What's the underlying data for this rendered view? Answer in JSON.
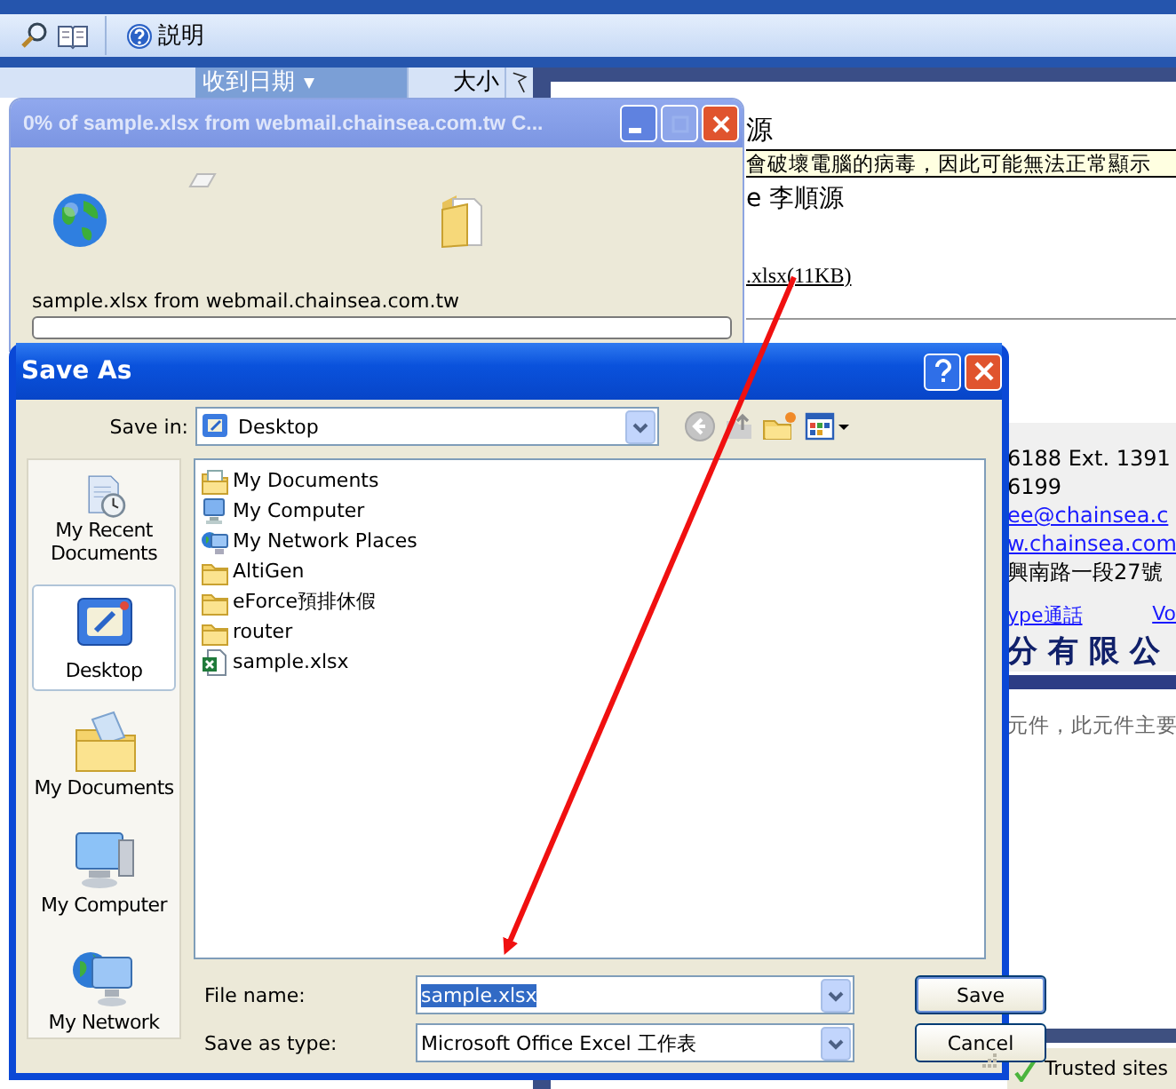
{
  "browser": {
    "toolbar": {
      "help_label": "説明"
    },
    "message_list": {
      "columns": [
        {
          "label": "收到日期",
          "selected": true
        },
        {
          "label": "大小",
          "selected": false
        }
      ]
    },
    "reading_pane": {
      "sender_fragment": "源",
      "notice": "會破壞電腦的病毒，因此可能無法正常顯示",
      "recipient_fragment": "e 李順源",
      "attachment_link": ".xlsx(11KB)",
      "signature": {
        "lines": [
          {
            "text": "6188 Ext. 1391",
            "kind": "text"
          },
          {
            "text": "6199",
            "kind": "text"
          },
          {
            "text": "ee@chainsea.c",
            "kind": "link"
          },
          {
            "text": "w.chainsea.com",
            "kind": "link"
          },
          {
            "text": "興南路一段27號",
            "kind": "text"
          }
        ],
        "links": [
          "ype通話",
          "Vo"
        ],
        "company": "分有限公"
      },
      "footer_note": "元件，此元件主要"
    },
    "status_bar": {
      "zone": "Trusted sites"
    }
  },
  "download_window": {
    "title": "0% of sample.xlsx from webmail.chainsea.com.tw C...",
    "source": "sample.xlsx from webmail.chainsea.com.tw",
    "level": 0
  },
  "save_dialog": {
    "title": "Save As",
    "save_in": {
      "label": "Save in:",
      "value": "Desktop"
    },
    "places": [
      {
        "label": "My Recent Documents",
        "kind": "recent",
        "selected": false
      },
      {
        "label": "Desktop",
        "kind": "desktop",
        "selected": true
      },
      {
        "label": "My Documents",
        "kind": "documents",
        "selected": false
      },
      {
        "label": "My Computer",
        "kind": "computer",
        "selected": false
      },
      {
        "label": "My Network",
        "kind": "network",
        "selected": false
      }
    ],
    "files": [
      {
        "name": "My Documents",
        "kind": "documents"
      },
      {
        "name": "My Computer",
        "kind": "computer"
      },
      {
        "name": "My Network Places",
        "kind": "network"
      },
      {
        "name": "AltiGen",
        "kind": "folder"
      },
      {
        "name": "eForce預排休假",
        "kind": "folder"
      },
      {
        "name": "router",
        "kind": "folder"
      },
      {
        "name": "sample.xlsx",
        "kind": "excel"
      }
    ],
    "file_name": {
      "label": "File name:",
      "value": "sample.xlsx",
      "text_selected": true
    },
    "save_type": {
      "label": "Save as type:",
      "value": "Microsoft Office Excel 工作表"
    },
    "buttons": [
      {
        "label": "Save",
        "default": true
      },
      {
        "label": "Cancel",
        "default": false
      }
    ]
  }
}
